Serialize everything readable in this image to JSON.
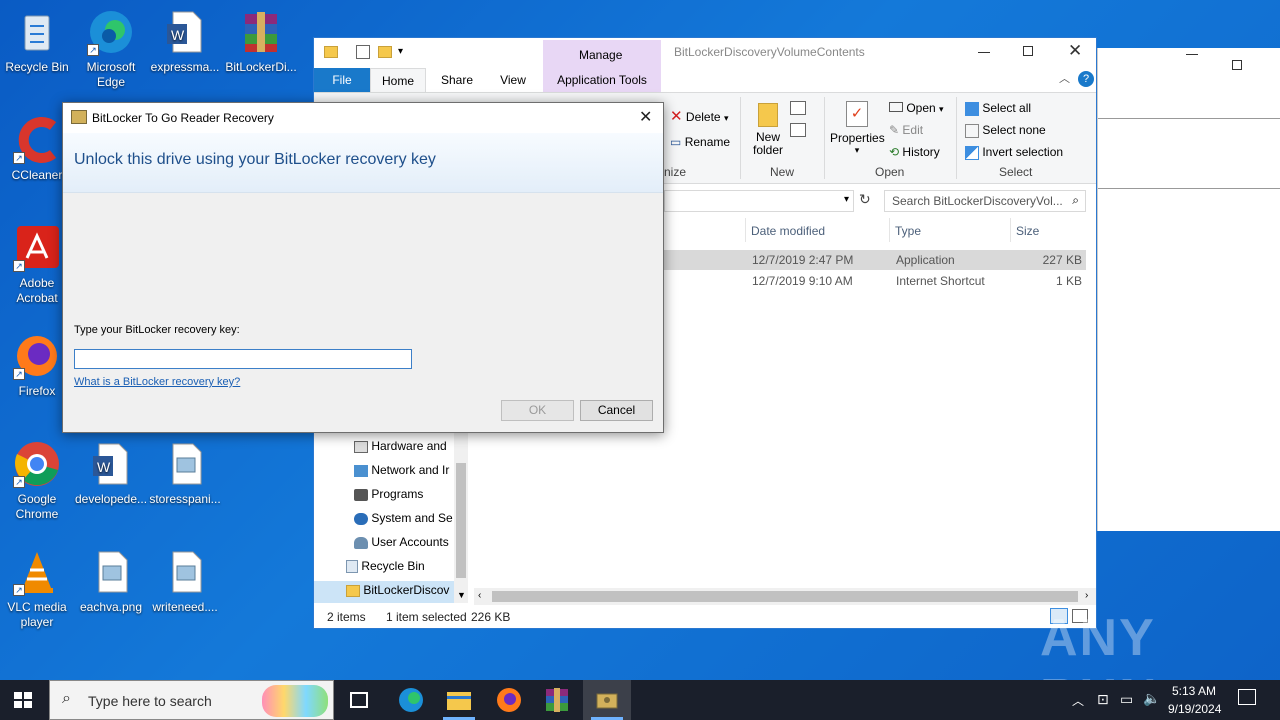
{
  "desktop": {
    "icons": [
      {
        "label": "Recycle Bin"
      },
      {
        "label": "Microsoft Edge"
      },
      {
        "label": "expressma..."
      },
      {
        "label": "BitLockerDi..."
      },
      {
        "label": "CCleaner"
      },
      {
        "label": "Adobe Acrobat"
      },
      {
        "label": "Firefox"
      },
      {
        "label": "Google Chrome"
      },
      {
        "label": "developede..."
      },
      {
        "label": "storesspani..."
      },
      {
        "label": "VLC media player"
      },
      {
        "label": "eachva.png"
      },
      {
        "label": "writeneed...."
      }
    ]
  },
  "explorer": {
    "title": "BitLockerDiscoveryVolumeContents",
    "manage_label": "Manage",
    "tabs": [
      "File",
      "Home",
      "Share",
      "View",
      "Application Tools"
    ],
    "ribbon": {
      "delete": "Delete",
      "rename": "Rename",
      "new_folder": "New folder",
      "properties": "Properties",
      "open": "Open",
      "edit": "Edit",
      "history": "History",
      "select_all": "Select all",
      "select_none": "Select none",
      "invert_selection": "Invert selection",
      "groups": {
        "organize": "nize",
        "new": "New",
        "open": "Open",
        "select": "Select"
      }
    },
    "search_placeholder": "Search BitLockerDiscoveryVol...",
    "columns": {
      "date": "Date modified",
      "type": "Type",
      "size": "Size"
    },
    "rows": [
      {
        "date": "12/7/2019 2:47 PM",
        "type": "Application",
        "size": "227 KB"
      },
      {
        "date": "12/7/2019 9:10 AM",
        "type": "Internet Shortcut",
        "size": "1 KB"
      }
    ],
    "nav": [
      {
        "label": "Hardware and"
      },
      {
        "label": "Network and Ir"
      },
      {
        "label": "Programs"
      },
      {
        "label": "System and Se"
      },
      {
        "label": "User Accounts"
      },
      {
        "label": "Recycle Bin"
      },
      {
        "label": "BitLockerDiscov"
      }
    ],
    "status": {
      "items": "2 items",
      "selected": "1 item selected",
      "size": "226 KB"
    }
  },
  "dialog": {
    "title": "BitLocker To Go Reader Recovery",
    "heading": "Unlock this drive using your BitLocker recovery key",
    "prompt": "Type your BitLocker recovery key:",
    "input_value": "",
    "link": "What is a BitLocker recovery key?",
    "ok": "OK",
    "cancel": "Cancel"
  },
  "taskbar": {
    "search_placeholder": "Type here to search",
    "time": "5:13 AM",
    "date": "9/19/2024"
  },
  "watermark": "ANY RUN"
}
